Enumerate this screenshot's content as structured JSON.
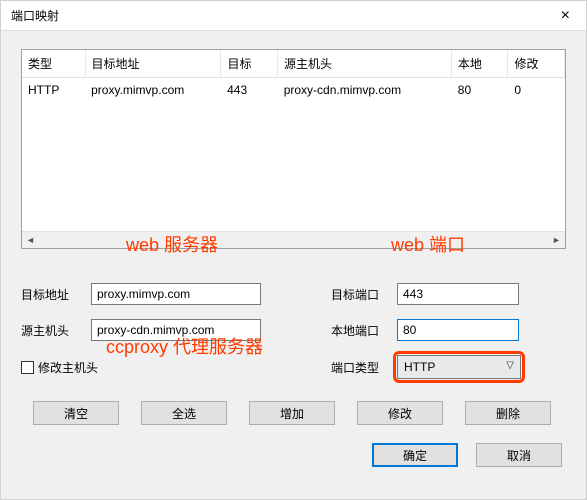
{
  "window": {
    "title": "端口映射",
    "close_glyph": "×"
  },
  "table": {
    "headers": {
      "type": "类型",
      "target_addr": "目标地址",
      "target": "目标",
      "src_host": "源主机头",
      "local": "本地",
      "modify": "修改"
    },
    "row": {
      "type": "HTTP",
      "target_addr": "proxy.mimvp.com",
      "target": "443",
      "src_host": "proxy-cdn.mimvp.com",
      "local": "80",
      "modify": "0"
    }
  },
  "annotations": {
    "web_server": "web 服务器",
    "web_port": "web 端口",
    "ccproxy": "ccproxy 代理服务器"
  },
  "form": {
    "target_addr_label": "目标地址",
    "target_addr_value": "proxy.mimvp.com",
    "src_host_label": "源主机头",
    "src_host_value": "proxy-cdn.mimvp.com",
    "modify_host_label": "修改主机头",
    "target_port_label": "目标端口",
    "target_port_value": "443",
    "local_port_label": "本地端口",
    "local_port_value": "80",
    "port_type_label": "端口类型",
    "port_type_value": "HTTP"
  },
  "buttons": {
    "clear": "清空",
    "select_all": "全选",
    "add": "增加",
    "edit": "修改",
    "delete": "删除",
    "ok": "确定",
    "cancel": "取消"
  },
  "scroll": {
    "left": "◄",
    "right": "►"
  }
}
